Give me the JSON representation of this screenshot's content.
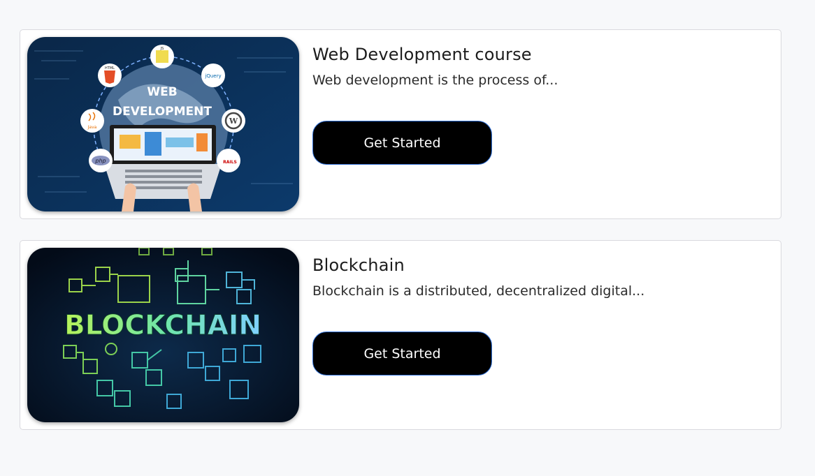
{
  "courses": [
    {
      "title": "Web Development course",
      "description": "Web development is the process of...",
      "cta_label": "Get Started",
      "image": {
        "banner_line1": "WEB",
        "banner_line2": "DEVELOPMENT",
        "badges": [
          "HTML",
          "JS",
          "jQuery",
          "Java",
          "php",
          "RAILS"
        ]
      }
    },
    {
      "title": "Blockchain",
      "description": "Blockchain is a distributed, decentralized digital...",
      "cta_label": "Get Started",
      "image": {
        "banner": "BLOCKCHAIN"
      }
    }
  ],
  "colors": {
    "page_background": "#f7f8fa",
    "card_background": "#ffffff",
    "button_background": "#000000",
    "button_border": "#2f6fd6",
    "web_dev_image_bg": "#0b2f5a",
    "blockchain_image_bg": "#04101f"
  }
}
